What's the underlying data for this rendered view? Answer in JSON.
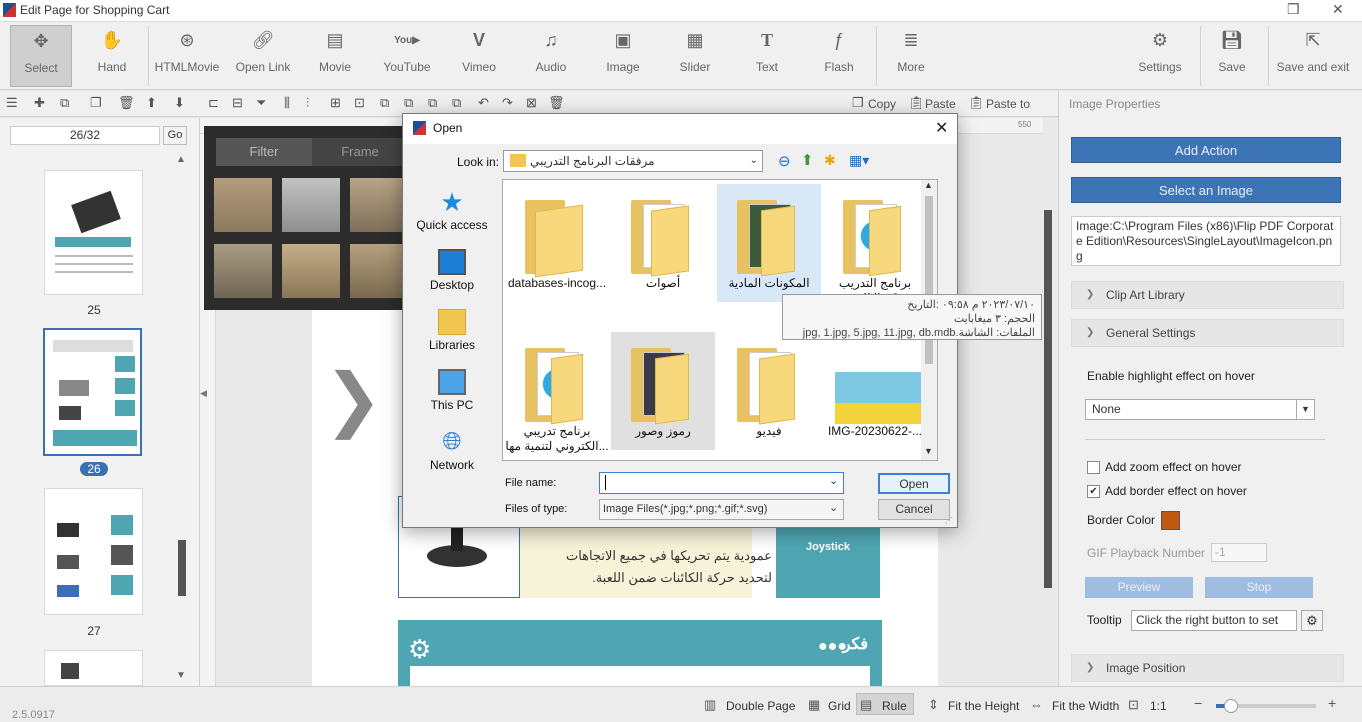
{
  "window": {
    "title": "Edit Page for Shopping Cart",
    "version": "2.5.0917"
  },
  "ribbon": {
    "tools": [
      {
        "label": "Select",
        "icon": "select-icon"
      },
      {
        "label": "Hand",
        "icon": "hand-icon"
      },
      {
        "label": "HTMLMovie",
        "icon": "film-reel-icon"
      },
      {
        "label": "Open Link",
        "icon": "link-icon"
      },
      {
        "label": "Movie",
        "icon": "movie-icon"
      },
      {
        "label": "YouTube",
        "icon": "youtube-icon"
      },
      {
        "label": "Vimeo",
        "icon": "vimeo-icon"
      },
      {
        "label": "Audio",
        "icon": "music-note-icon"
      },
      {
        "label": "Image",
        "icon": "image-icon"
      },
      {
        "label": "Slider",
        "icon": "slider-icon"
      },
      {
        "label": "Text",
        "icon": "text-icon"
      },
      {
        "label": "Flash",
        "icon": "flash-icon"
      },
      {
        "label": "More",
        "icon": "more-icon"
      }
    ],
    "right": [
      {
        "label": "Settings",
        "icon": "gear-icon"
      },
      {
        "label": "Save",
        "icon": "save-icon"
      },
      {
        "label": "Save and exit",
        "icon": "exit-icon"
      }
    ]
  },
  "toolbar2": {
    "copy": "Copy",
    "paste": "Paste",
    "paste_to": "Paste to"
  },
  "left_panel": {
    "page_input": "26/32",
    "go": "Go",
    "pages": [
      {
        "label": "25"
      },
      {
        "label": "26"
      },
      {
        "label": "27"
      }
    ]
  },
  "canvas": {
    "filter_tab": "Filter",
    "frame_tab": "Frame",
    "ruler_mark": "550",
    "body_line1": "عمودية يتم تحريكها في جميع الاتجاهات",
    "body_line2": "لتحديد حركة الكائنات ضمن اللعبة.",
    "joystick_label": "Joystick",
    "think_heading": "فكر"
  },
  "right_panel": {
    "header": "Image Properties",
    "add_action": "Add Action",
    "select_image": "Select an Image",
    "image_path": "Image:C:\\Program Files (x86)\\Flip PDF Corporate Edition\\Resources\\SingleLayout\\ImageIcon.png",
    "clip_art": "Clip Art Library",
    "general_settings": "General Settings",
    "highlight_label": "Enable highlight effect on hover",
    "highlight_value": "None",
    "zoom_effect": "Add zoom effect on hover",
    "border_effect": "Add border effect on hover",
    "border_color_label": "Border Color",
    "border_color": "#c0580f",
    "gif_label": "GIF Playback Number",
    "gif_value": "-1",
    "preview": "Preview",
    "stop": "Stop",
    "tooltip_label": "Tooltip",
    "tooltip_value": "Click the right button to set",
    "image_position": "Image Position"
  },
  "statusbar": {
    "double_page": "Double Page",
    "grid": "Grid",
    "rule": "Rule",
    "fit_height": "Fit the Height",
    "fit_width": "Fit the Width",
    "ratio": "1:1",
    "zoom_level": 0.15
  },
  "dialog": {
    "title": "Open",
    "look_in_label": "Look in:",
    "look_in_value": "مرفقات البرنامج التدريبي",
    "places": [
      "Quick access",
      "Desktop",
      "Libraries",
      "This PC",
      "Network"
    ],
    "files": [
      {
        "name": "databases-incog...",
        "kind": "folder"
      },
      {
        "name": "أصوات",
        "kind": "folder"
      },
      {
        "name": "المكونات المادية",
        "kind": "folder"
      },
      {
        "name": "برنامج التدريب الالكتروني - Sto...",
        "kind": "folder"
      },
      {
        "name": "برنامج تدريبي الكتروني لتنمية مها...",
        "kind": "folder"
      },
      {
        "name": "رموز وصور",
        "kind": "folder"
      },
      {
        "name": "فيديو",
        "kind": "folder"
      },
      {
        "name": "IMG-20230622-...",
        "kind": "image"
      }
    ],
    "tooltip_line1": "٢٠٢٣/٠٧/١٠ م ٠٩:٥٨ :التاريخ",
    "tooltip_line2": "الحجم: ٣ ميغابايت",
    "tooltip_line3": "الملفات: الشاشة.jpg, 1.jpg, 5.jpg, 11.jpg, db.mdb",
    "file_name_label": "File name:",
    "file_name_value": "",
    "files_of_type_label": "Files of type:",
    "files_of_type_value": "Image Files(*.jpg;*.png;*.gif;*.svg)",
    "open_btn": "Open",
    "cancel_btn": "Cancel"
  }
}
